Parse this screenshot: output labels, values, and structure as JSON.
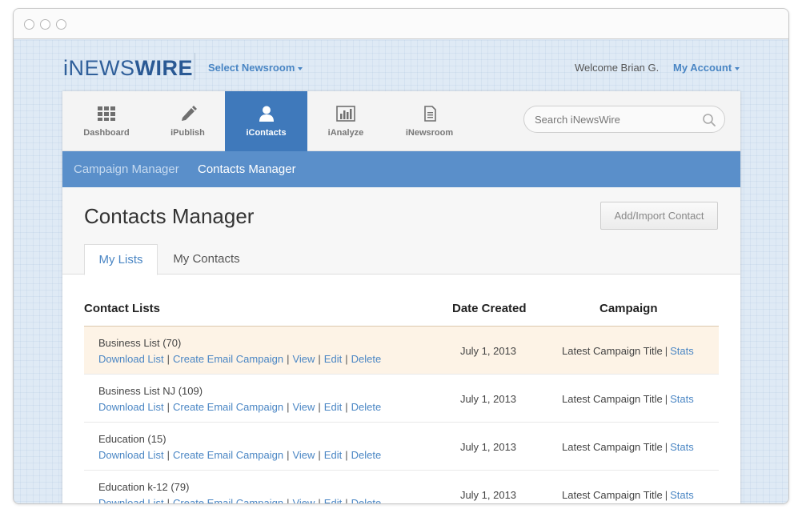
{
  "header": {
    "logo_thin": "iNEWS",
    "logo_bold": "WIRE",
    "select_newsroom": "Select Newsroom",
    "welcome": "Welcome Brian G.",
    "my_account": "My Account"
  },
  "nav": {
    "items": [
      {
        "label": "Dashboard",
        "icon": "grid-icon"
      },
      {
        "label": "iPublish",
        "icon": "pencil-icon"
      },
      {
        "label": "iContacts",
        "icon": "person-icon",
        "active": true
      },
      {
        "label": "iAnalyze",
        "icon": "bar-chart-icon"
      },
      {
        "label": "iNewsroom",
        "icon": "document-icon"
      }
    ],
    "search_placeholder": "Search iNewsWire"
  },
  "subnav": {
    "campaign_manager": "Campaign Manager",
    "contacts_manager": "Contacts Manager"
  },
  "page": {
    "title": "Contacts Manager",
    "add_button": "Add/Import Contact",
    "tabs": [
      "My Lists",
      "My Contacts"
    ]
  },
  "table": {
    "columns": [
      "Contact Lists",
      "Date Created",
      "Campaign"
    ],
    "action_labels": [
      "Download List",
      "Create Email Campaign",
      "View",
      "Edit",
      "Delete"
    ],
    "rows": [
      {
        "name": "Business List (70)",
        "date": "July 1, 2013",
        "campaign": "Latest Campaign Title",
        "stats": "Stats"
      },
      {
        "name": "Business List NJ (109)",
        "date": "July 1, 2013",
        "campaign": "Latest Campaign Title",
        "stats": "Stats"
      },
      {
        "name": "Education (15)",
        "date": "July 1, 2013",
        "campaign": "Latest Campaign Title",
        "stats": "Stats"
      },
      {
        "name": "Education k-12 (79)",
        "date": "July 1, 2013",
        "campaign": "Latest Campaign Title",
        "stats": "Stats"
      }
    ]
  },
  "colors": {
    "brand_blue": "#3f79bb",
    "subnav_blue": "#5a8fca",
    "link_blue": "#4a86c4",
    "row_highlight": "#fdf3e6"
  }
}
